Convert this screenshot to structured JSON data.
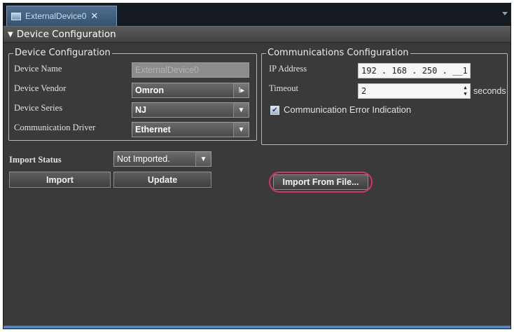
{
  "tab": {
    "label": "ExternalDevice0",
    "close_glyph": "✕"
  },
  "section": {
    "collapse_glyph": "▼",
    "title": "Device Configuration"
  },
  "device_config": {
    "title": "Device Configuration",
    "device_name": {
      "label": "Device Name",
      "value": "ExternalDevice0"
    },
    "device_vendor": {
      "label": "Device Vendor",
      "value": "Omron",
      "button_glyph": "⁞▸"
    },
    "device_series": {
      "label": "Device Series",
      "value": "NJ",
      "button_glyph": "▼"
    },
    "comm_driver": {
      "label": "Communication Driver",
      "value": "Ethernet",
      "button_glyph": "▼"
    }
  },
  "comm_config": {
    "title": "Communications Configuration",
    "ip_address": {
      "label": "IP Address",
      "value": "192 . 168 . 250 . __1"
    },
    "timeout": {
      "label": "Timeout",
      "value": "2",
      "unit": "seconds",
      "spin_up": "▲",
      "spin_down": "▼"
    },
    "comm_error": {
      "label": "Communication Error Indication",
      "checked": true,
      "check_glyph": "✔"
    }
  },
  "import_status": {
    "label": "Import Status",
    "value": "Not Imported.",
    "button_glyph": "▼"
  },
  "buttons": {
    "import": "Import",
    "update": "Update",
    "import_from_file": "Import From File..."
  },
  "colors": {
    "panel_bg": "#3a3a3a",
    "tab_active": "#4f6f8e",
    "highlight": "#d5336a",
    "accent_bar": "#4a86c6"
  }
}
